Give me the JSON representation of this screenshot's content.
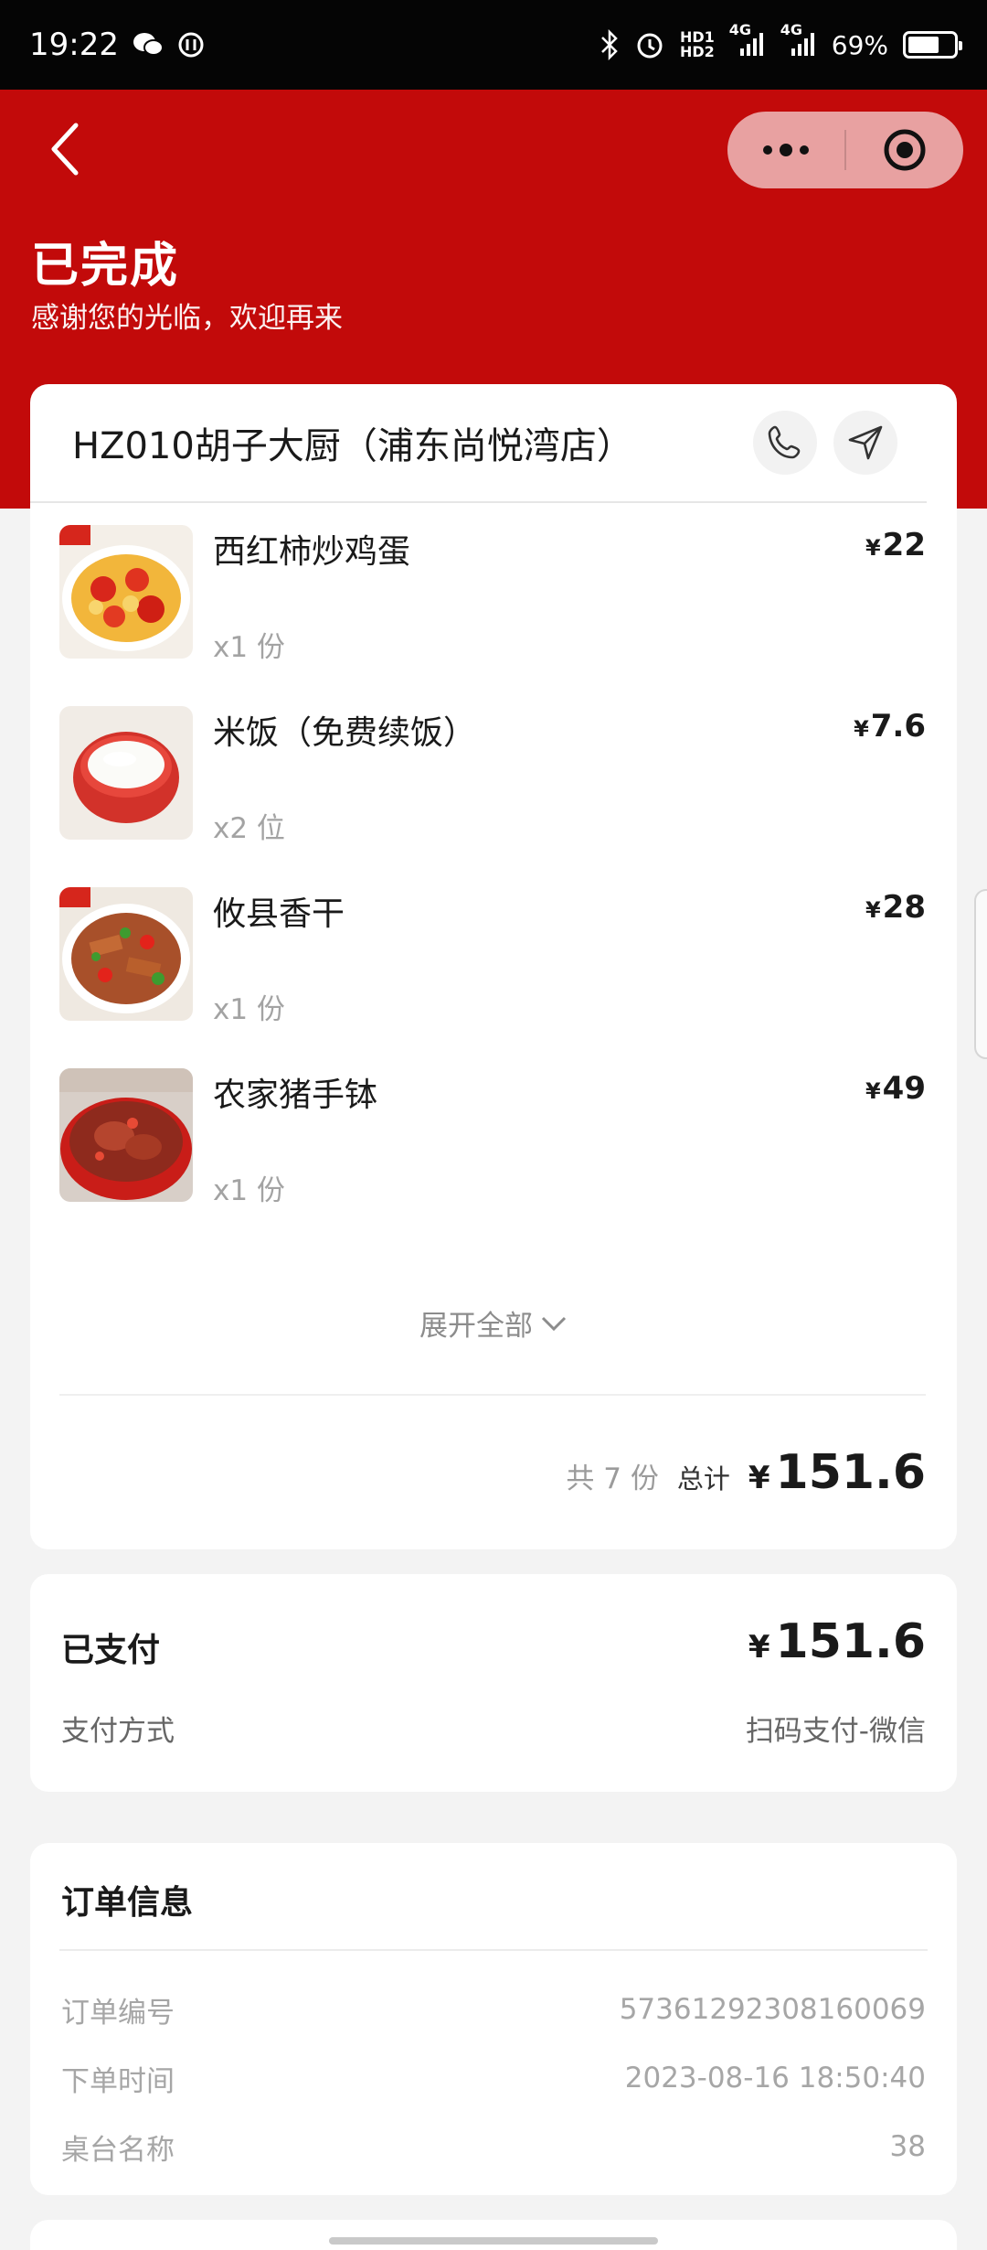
{
  "status_bar": {
    "time": "19:22",
    "network_hd": "HD1\nHD2",
    "signal1": "4G",
    "signal2": "4G",
    "battery": "69%",
    "battery_level": 0.69,
    "icons": [
      "wechat-icon",
      "sync-icon",
      "bluetooth-icon",
      "alarm-icon",
      "signal-icon",
      "battery-icon"
    ]
  },
  "header": {
    "title": "已完成",
    "subtitle": "感谢您的光临，欢迎再来",
    "background": "#c20a0a"
  },
  "store": {
    "name": "HZ010胡子大厨（浦东尚悦湾店）"
  },
  "items": [
    {
      "name": "西红柿炒鸡蛋",
      "qty": "x1 份",
      "currency": "¥",
      "price": "22"
    },
    {
      "name": "米饭（免费续饭）",
      "qty": "x2 位",
      "currency": "¥",
      "price": "7.6"
    },
    {
      "name": "攸县香干",
      "qty": "x1 份",
      "currency": "¥",
      "price": "28"
    },
    {
      "name": "农家猪手钵",
      "qty": "x1 份",
      "currency": "¥",
      "price": "49"
    }
  ],
  "expand_label": "展开全部",
  "summary": {
    "count": "共 7 份",
    "total_label": "总计",
    "currency": "¥",
    "total": "151.6"
  },
  "payment": {
    "title": "已支付",
    "currency": "¥",
    "amount": "151.6",
    "method_label": "支付方式",
    "method_value": "扫码支付-微信"
  },
  "order_info": {
    "title": "订单信息",
    "rows": [
      {
        "label": "订单编号",
        "value": "57361292308160069"
      },
      {
        "label": "下单时间",
        "value": "2023-08-16 18:50:40"
      },
      {
        "label": "桌台名称",
        "value": "38"
      }
    ]
  }
}
